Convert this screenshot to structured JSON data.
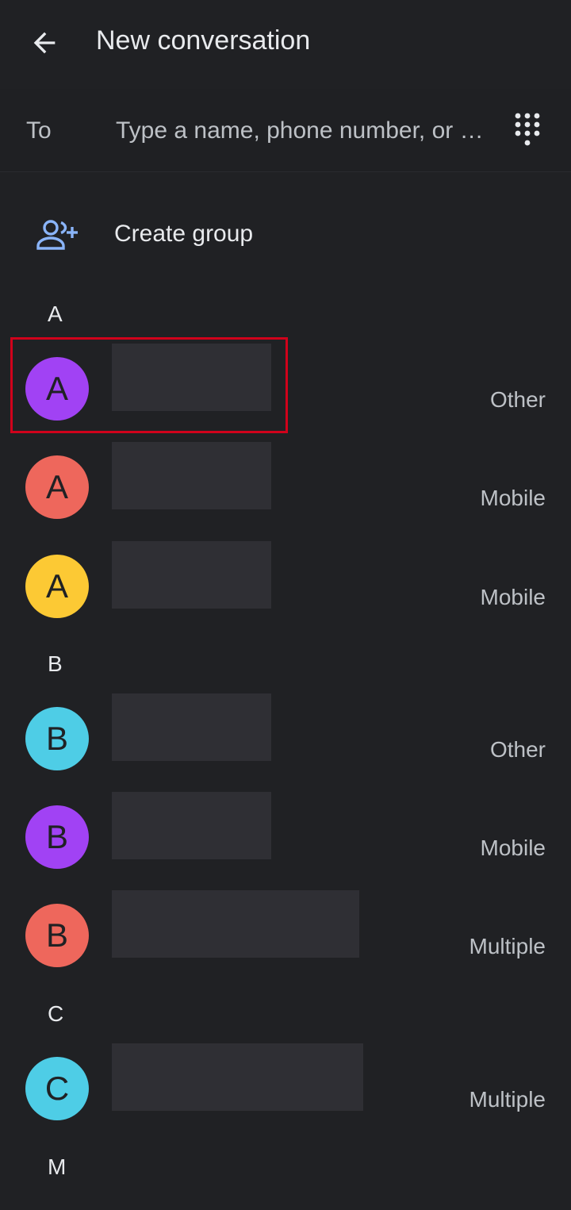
{
  "app_bar": {
    "title": "New conversation",
    "back_icon": "arrow-left-icon"
  },
  "to_row": {
    "label": "To",
    "placeholder": "Type a name, phone number, or …",
    "dialpad_icon": "dialpad-icon"
  },
  "create_group": {
    "label": "Create group",
    "icon": "add-group-icon",
    "icon_color": "#8ab4f8"
  },
  "sections": [
    {
      "letter": "A",
      "contacts": [
        {
          "initial": "A",
          "color": "#a142f4",
          "type": "Other"
        },
        {
          "initial": "A",
          "color": "#ee675c",
          "type": "Mobile"
        },
        {
          "initial": "A",
          "color": "#fcc934",
          "type": "Mobile"
        }
      ]
    },
    {
      "letter": "B",
      "contacts": [
        {
          "initial": "B",
          "color": "#4ecde6",
          "type": "Other"
        },
        {
          "initial": "B",
          "color": "#a142f4",
          "type": "Mobile"
        },
        {
          "initial": "B",
          "color": "#ee675c",
          "type": "Multiple"
        }
      ]
    },
    {
      "letter": "C",
      "contacts": [
        {
          "initial": "C",
          "color": "#4ecde6",
          "type": "Multiple"
        }
      ]
    },
    {
      "letter": "M",
      "contacts": []
    }
  ]
}
